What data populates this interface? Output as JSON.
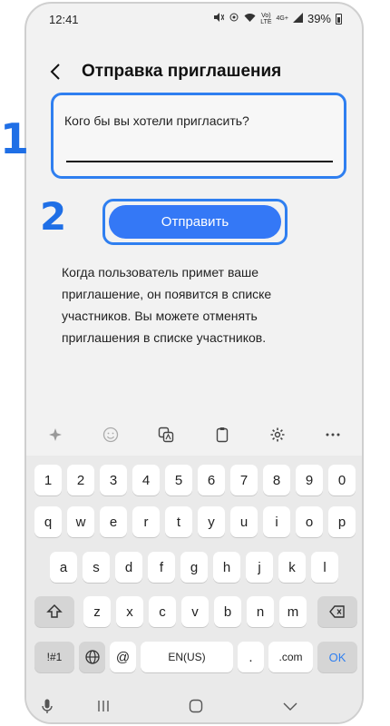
{
  "status_bar": {
    "time": "12:41",
    "net_top": "Vo)",
    "net_bottom": "LTE",
    "net_gen": "4G+",
    "battery": "39%"
  },
  "header": {
    "title": "Отправка приглашения"
  },
  "invite_form": {
    "label": "Кого бы вы хотели пригласить?",
    "value": "",
    "send_label": "Отправить"
  },
  "markers": {
    "first": "1",
    "second": "2"
  },
  "info": {
    "text": "Когда пользователь примет ваше приглашение, он появится в списке участников. Вы можете отменять приглашения в списке участников."
  },
  "keyboard": {
    "row_numbers": [
      "1",
      "2",
      "3",
      "4",
      "5",
      "6",
      "7",
      "8",
      "9",
      "0"
    ],
    "row_1": [
      "q",
      "w",
      "e",
      "r",
      "t",
      "y",
      "u",
      "i",
      "o",
      "p"
    ],
    "row_2": [
      "a",
      "s",
      "d",
      "f",
      "g",
      "h",
      "j",
      "k",
      "l"
    ],
    "row_3": [
      "z",
      "x",
      "c",
      "v",
      "b",
      "n",
      "m"
    ],
    "symbols": "!#1",
    "at": "@",
    "space": "EN(US)",
    "dot": ".",
    "dotcom": ".com",
    "ok": "OK"
  },
  "colors": {
    "accent": "#3478f6",
    "highlight": "#2f7ff0",
    "marker": "#1f6fe6"
  }
}
